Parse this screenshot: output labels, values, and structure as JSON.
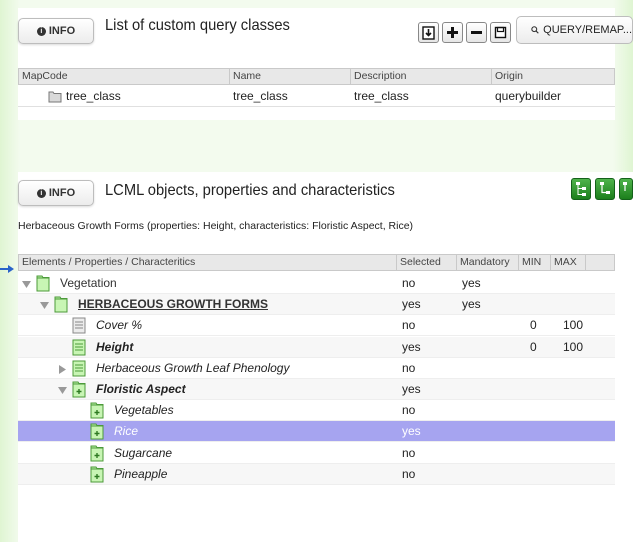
{
  "top_panel": {
    "info_label": "INFO",
    "title": "List of custom query classes",
    "query_button_label": "QUERY/REMAP...",
    "columns": [
      "MapCode",
      "Name",
      "Description",
      "Origin"
    ],
    "rows": [
      {
        "mapcode": "tree_class",
        "name": "tree_class",
        "description": "tree_class",
        "origin": "querybuilder"
      }
    ]
  },
  "lcml_panel": {
    "info_label": "INFO",
    "title": "LCML objects, properties and characteristics",
    "subtitle": "Herbaceous Growth Forms (properties: Height, characteristics: Floristic Aspect, Rice)",
    "columns": [
      "Elements / Properties / Characteritics",
      "Selected",
      "Mandatory",
      "MIN",
      "MAX"
    ],
    "rows": [
      {
        "label": "Vegetation",
        "selected": "no",
        "mandatory": "yes",
        "min": "",
        "max": ""
      },
      {
        "label": "HERBACEOUS GROWTH FORMS",
        "selected": "yes",
        "mandatory": "yes",
        "min": "",
        "max": ""
      },
      {
        "label": "Cover %",
        "selected": "no",
        "mandatory": "",
        "min": "0",
        "max": "100"
      },
      {
        "label": "Height",
        "selected": "yes",
        "mandatory": "",
        "min": "0",
        "max": "100"
      },
      {
        "label": "Herbaceous Growth Leaf Phenology",
        "selected": "no",
        "mandatory": "",
        "min": "",
        "max": ""
      },
      {
        "label": "Floristic Aspect",
        "selected": "yes",
        "mandatory": "",
        "min": "",
        "max": ""
      },
      {
        "label": "Vegetables",
        "selected": "no",
        "mandatory": "",
        "min": "",
        "max": ""
      },
      {
        "label": "Rice",
        "selected": "yes",
        "mandatory": "",
        "min": "",
        "max": ""
      },
      {
        "label": "Sugarcane",
        "selected": "no",
        "mandatory": "",
        "min": "",
        "max": ""
      },
      {
        "label": "Pineapple",
        "selected": "no",
        "mandatory": "",
        "min": "",
        "max": ""
      }
    ]
  },
  "colors": {
    "highlight_row": "#a6a4f0",
    "folder_green": "#9fe08c",
    "green_button": "#2e9a2e"
  }
}
